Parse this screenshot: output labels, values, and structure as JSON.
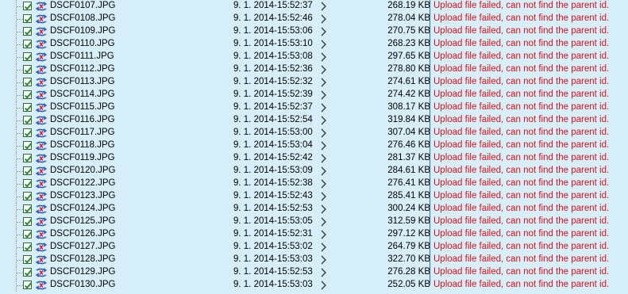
{
  "transfer_list": {
    "rows": [
      {
        "name": "DSCF0107.JPG",
        "date": "9. 1. 2014-15:52:37",
        "size": "268.19 KB",
        "status": "Upload file failed, can not find the parent id."
      },
      {
        "name": "DSCF0108.JPG",
        "date": "9. 1. 2014-15:52:46",
        "size": "278.04 KB",
        "status": "Upload file failed, can not find the parent id."
      },
      {
        "name": "DSCF0109.JPG",
        "date": "9. 1. 2014-15:53:06",
        "size": "270.75 KB",
        "status": "Upload file failed, can not find the parent id."
      },
      {
        "name": "DSCF0110.JPG",
        "date": "9. 1. 2014-15:53:10",
        "size": "268.23 KB",
        "status": "Upload file failed, can not find the parent id."
      },
      {
        "name": "DSCF0111.JPG",
        "date": "9. 1. 2014-15:53:08",
        "size": "297.65 KB",
        "status": "Upload file failed, can not find the parent id."
      },
      {
        "name": "DSCF0112.JPG",
        "date": "9. 1. 2014-15:52:36",
        "size": "278.80 KB",
        "status": "Upload file failed, can not find the parent id."
      },
      {
        "name": "DSCF0113.JPG",
        "date": "9. 1. 2014-15:52:32",
        "size": "274.61 KB",
        "status": "Upload file failed, can not find the parent id."
      },
      {
        "name": "DSCF0114.JPG",
        "date": "9. 1. 2014-15:52:39",
        "size": "274.42 KB",
        "status": "Upload file failed, can not find the parent id."
      },
      {
        "name": "DSCF0115.JPG",
        "date": "9. 1. 2014-15:52:37",
        "size": "308.17 KB",
        "status": "Upload file failed, can not find the parent id."
      },
      {
        "name": "DSCF0116.JPG",
        "date": "9. 1. 2014-15:52:54",
        "size": "319.84 KB",
        "status": "Upload file failed, can not find the parent id."
      },
      {
        "name": "DSCF0117.JPG",
        "date": "9. 1. 2014-15:53:00",
        "size": "307.04 KB",
        "status": "Upload file failed, can not find the parent id."
      },
      {
        "name": "DSCF0118.JPG",
        "date": "9. 1. 2014-15:53:04",
        "size": "276.46 KB",
        "status": "Upload file failed, can not find the parent id."
      },
      {
        "name": "DSCF0119.JPG",
        "date": "9. 1. 2014-15:52:42",
        "size": "281.37 KB",
        "status": "Upload file failed, can not find the parent id."
      },
      {
        "name": "DSCF0120.JPG",
        "date": "9. 1. 2014-15:53:09",
        "size": "284.61 KB",
        "status": "Upload file failed, can not find the parent id."
      },
      {
        "name": "DSCF0122.JPG",
        "date": "9. 1. 2014-15:52:38",
        "size": "276.41 KB",
        "status": "Upload file failed, can not find the parent id."
      },
      {
        "name": "DSCF0123.JPG",
        "date": "9. 1. 2014-15:52:43",
        "size": "285.41 KB",
        "status": "Upload file failed, can not find the parent id."
      },
      {
        "name": "DSCF0124.JPG",
        "date": "9. 1. 2014-15:52:53",
        "size": "300.24 KB",
        "status": "Upload file failed, can not find the parent id."
      },
      {
        "name": "DSCF0125.JPG",
        "date": "9. 1. 2014-15:53:05",
        "size": "312.59 KB",
        "status": "Upload file failed, can not find the parent id."
      },
      {
        "name": "DSCF0126.JPG",
        "date": "9. 1. 2014-15:52:31",
        "size": "297.12 KB",
        "status": "Upload file failed, can not find the parent id."
      },
      {
        "name": "DSCF0127.JPG",
        "date": "9. 1. 2014-15:53:02",
        "size": "264.79 KB",
        "status": "Upload file failed, can not find the parent id."
      },
      {
        "name": "DSCF0128.JPG",
        "date": "9. 1. 2014-15:53:03",
        "size": "322.70 KB",
        "status": "Upload file failed, can not find the parent id."
      },
      {
        "name": "DSCF0129.JPG",
        "date": "9. 1. 2014-15:52:53",
        "size": "276.28 KB",
        "status": "Upload file failed, can not find the parent id."
      },
      {
        "name": "DSCF0130.JPG",
        "date": "9. 1. 2014-15:53:03",
        "size": "252.05 KB",
        "status": "Upload file failed, can not find the parent id."
      }
    ]
  },
  "icons": {
    "checkbox": "checkbox-checked-icon",
    "file": "upload-transfer-icon",
    "arrow": "chevron-right-icon"
  },
  "colors": {
    "background": "#d7effb",
    "status_error": "#e01010",
    "checkbox_check": "#2e8b2e",
    "divider": "#1f6fc8"
  }
}
